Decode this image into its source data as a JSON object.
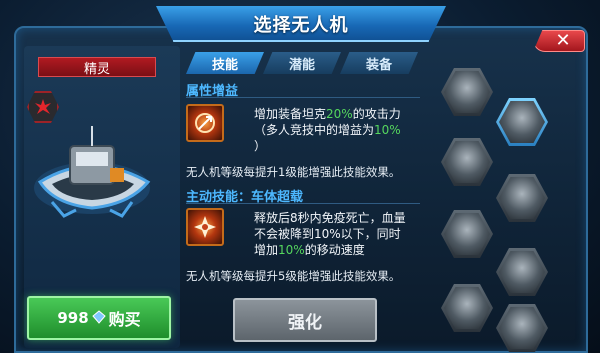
{
  "header": {
    "title": "选择无人机"
  },
  "close": {
    "label": "✕"
  },
  "drone": {
    "name": "精灵",
    "class_icon": "red-burst-icon"
  },
  "buy": {
    "price": "998",
    "currency_icon": "diamond-icon",
    "label": "购买"
  },
  "tabs": [
    {
      "label": "技能",
      "active": true
    },
    {
      "label": "潜能",
      "active": false
    },
    {
      "label": "装备",
      "active": false
    }
  ],
  "skills": {
    "passive_title": "属性增益",
    "passive_desc_1": "增加装备坦克",
    "passive_pct": "20%",
    "passive_desc_2": "的攻击力",
    "passive_desc_3": "（多人竞技中的增益为",
    "passive_pvp_pct": "10%",
    "passive_desc_4": "）",
    "passive_note": "无人机等级每提升1级能增强此技能效果。",
    "active_title": "主动技能：车体超载",
    "active_desc_1": "释放后8秒内免疫死亡，血量",
    "active_desc_2": "不会被降到10%以下，同时",
    "active_desc_3a": "增加",
    "active_pct": "10%",
    "active_desc_3b": "的移动速度",
    "active_note": "无人机等级每提升5级能增强此技能效果。"
  },
  "upgrade": {
    "label": "强化"
  },
  "accent_colors": {
    "highlight": "#55d65e",
    "section": "#4db8ff",
    "buy": "#2fae3c",
    "name_bar": "#9b1a20"
  }
}
